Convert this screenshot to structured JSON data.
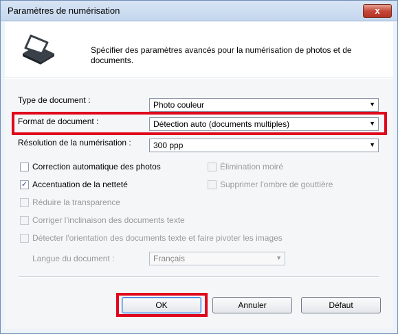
{
  "window": {
    "title": "Paramètres de numérisation",
    "close_label": "x"
  },
  "header": {
    "icon": "scanner-icon",
    "description": "Spécifier des paramètres avancés pour la numérisation de photos et de documents."
  },
  "fields": {
    "doc_type": {
      "label": "Type de document :",
      "value": "Photo couleur"
    },
    "doc_format": {
      "label": "Format de document :",
      "value": "Détection auto (documents multiples)"
    },
    "resolution": {
      "label": "Résolution de la numérisation :",
      "value": "300 ppp"
    },
    "language": {
      "label": "Langue du document :",
      "value": "Français"
    }
  },
  "checkboxes": {
    "auto_photo_fix": {
      "label": "Correction automatique des photos",
      "checked": false,
      "enabled": true
    },
    "unsharp": {
      "label": "Accentuation de la netteté",
      "checked": true,
      "enabled": true
    },
    "reduce_show_through": {
      "label": "Réduire la transparence",
      "checked": false,
      "enabled": false
    },
    "correct_slant": {
      "label": "Corriger l'inclinaison des documents texte",
      "checked": false,
      "enabled": false
    },
    "detect_orientation": {
      "label": "Détecter l'orientation des documents texte et faire pivoter les images",
      "checked": false,
      "enabled": false
    },
    "descreen": {
      "label": "Élimination moiré",
      "checked": false,
      "enabled": false
    },
    "gutter": {
      "label": "Supprimer l'ombre de gouttière",
      "checked": false,
      "enabled": false
    }
  },
  "buttons": {
    "ok": "OK",
    "cancel": "Annuler",
    "defaults": "Défaut"
  },
  "colors": {
    "highlight": "#e0061c",
    "titlebar": "#c5d7ee"
  }
}
